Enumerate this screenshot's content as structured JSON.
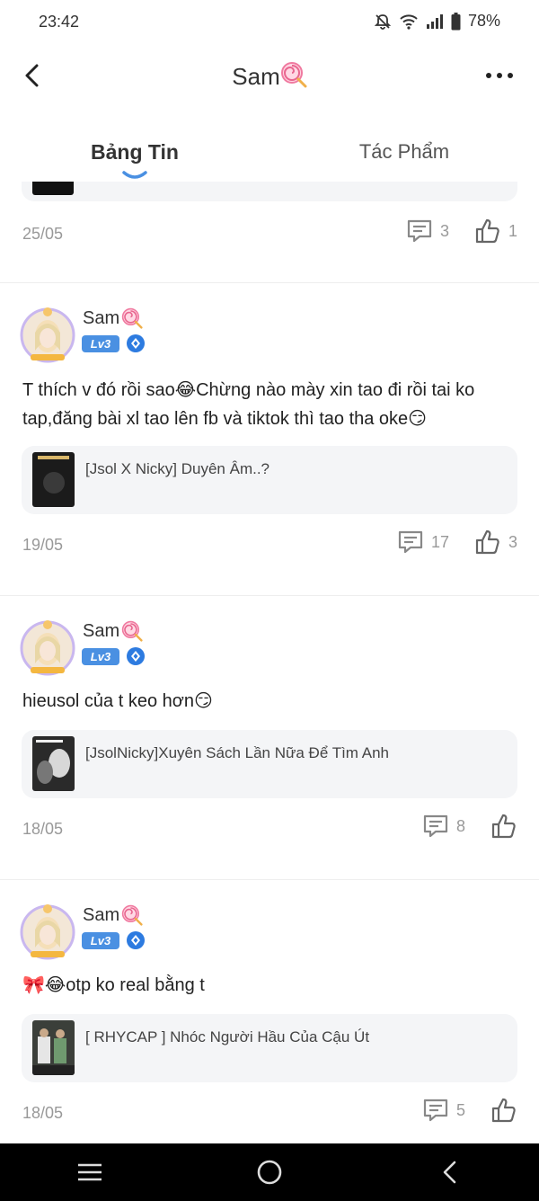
{
  "status_bar": {
    "time": "23:42",
    "battery": "78%"
  },
  "header": {
    "title": "Sam"
  },
  "tabs": [
    {
      "label": "Bảng Tin"
    },
    {
      "label": "Tác Phẩm"
    }
  ],
  "previous_post": {
    "date": "25/05",
    "comments": "3",
    "likes": "1"
  },
  "posts": [
    {
      "author": "Sam",
      "level": "Lv3",
      "text": "T thích v đó rồi sao😂Chừng nào mày xin tao đi rồi tai ko tap,đăng bài xl tao lên fb và tiktok thì tao tha oke😏",
      "book_title": "[Jsol X Nicky] Duyên Âm..?",
      "date": "19/05",
      "comments": "17",
      "likes": "3"
    },
    {
      "author": "Sam",
      "level": "Lv3",
      "text": "hieusol của t keo hơn😏",
      "book_title": "[JsolNicky]Xuyên Sách Lần Nữa Để Tìm Anh",
      "date": "18/05",
      "comments": "8",
      "likes": ""
    },
    {
      "author": "Sam",
      "level": "Lv3",
      "text": "🎀😂otp ko real bằng t",
      "book_title": "[ RHYCAP ] Nhóc Người Hầu Của Cậu Út",
      "date": "18/05",
      "comments": "5",
      "likes": ""
    }
  ],
  "colors": {
    "accent": "#4a90e2",
    "muted": "#999999",
    "card_bg": "#f4f5f7"
  },
  "icons": [
    "back-icon",
    "more-icon",
    "comment-icon",
    "like-icon",
    "lollipop-icon",
    "gem-icon",
    "menu-icon",
    "home-icon",
    "nav-back-icon"
  ]
}
